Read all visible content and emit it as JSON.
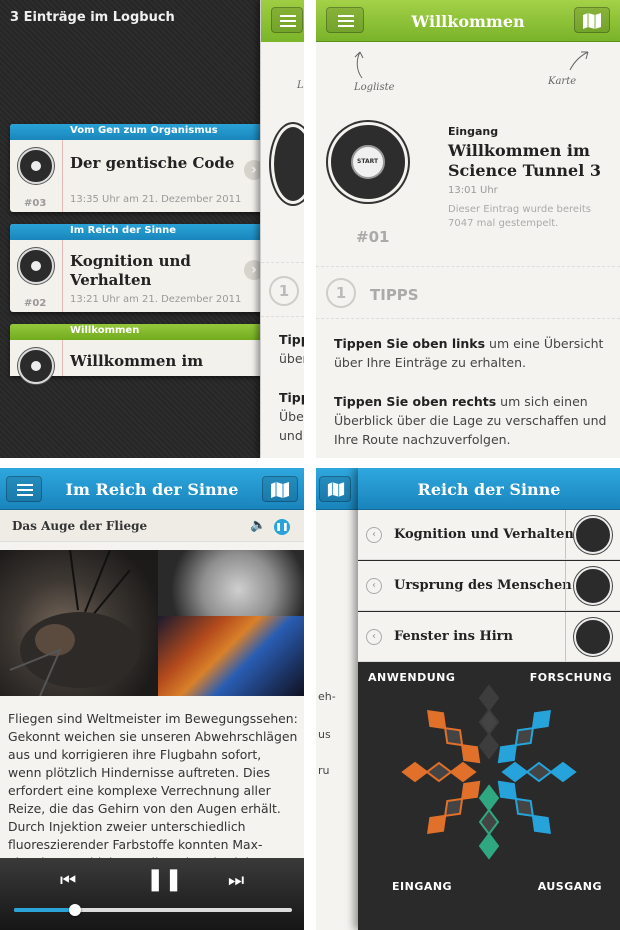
{
  "logbook": {
    "count_label": "3 Einträge im Logbuch",
    "entries": [
      {
        "category": "Vom Gen zum Organismus",
        "title": "Der gentische Code",
        "time": "13:35 Uhr am 21. Dezember 2011",
        "number": "#03",
        "color": "#1e8fc6"
      },
      {
        "category": "Im Reich der Sinne",
        "title": "Kognition und Verhalten",
        "time": "13:21 Uhr am 21. Dezember 2011",
        "number": "#02",
        "color": "#1e8fc6"
      },
      {
        "category": "Willkommen",
        "title": "Willkommen im",
        "time": "",
        "number": "",
        "color": "#7ab52a"
      }
    ],
    "overlay_fragments": [
      "L",
      "1",
      "Tipp",
      "über",
      "Tipp",
      "Übe",
      "und"
    ]
  },
  "welcome": {
    "bar_title": "Willkommen",
    "hint_left": "Logliste",
    "hint_right": "Karte",
    "seal_text": "START",
    "number": "#01",
    "tag": "Eingang",
    "title": "Willkommen im Science Tunnel 3",
    "time": "13:01 Uhr",
    "stamp_text": "Dieser Eintrag wurde bereits 7047 mal gestempelt.",
    "tips_number": "1",
    "tips_title": "TIPPS",
    "tip1_bold": "Tippen Sie oben links",
    "tip1_rest": " um eine Übersicht über Ihre Einträge zu erhalten.",
    "tip2_bold": "Tippen Sie oben rechts",
    "tip2_rest": " um sich einen Überblick über die Lage zu verschaffen und Ihre Route nachzuverfolgen.",
    "accent": "#7ab52a"
  },
  "station": {
    "bar_title": "Im Reich der Sinne",
    "sub_title": "Das Auge der Fliege",
    "body": "Fliegen sind Weltmeister im Bewegungssehen: Gekonnt weichen sie unseren Abwehrschlägen aus und korrigieren ihre Flugbahn sofort, wenn plötzlich Hindernisse auftreten. Dies erfordert eine komplexe Verrechnung aller Reize, die das Gehirn von den Augen erhält. Durch Injektion zweier unterschiedlich fluoreszierender Farbstoffe konnten Max-Planck-Neurobiologen die Reizweiterleitung sichtbar machen.",
    "player_progress": 0.22,
    "accent": "#1e8fc6"
  },
  "menu": {
    "bar_title": "Reich der Sinne",
    "items": [
      "Kognition und Verhalten",
      "Ursprung des Menschen",
      "Fenster ins Hirn"
    ],
    "corners": {
      "tl": "ANWENDUNG",
      "tr": "FORSCHUNG",
      "bl": "EINGANG",
      "br": "AUSGANG"
    },
    "under_fragments": [
      "eh-",
      "us",
      "ru"
    ],
    "colors": {
      "orange": "#e0702a",
      "blue": "#27a3db",
      "teal": "#2fa882",
      "dark": "#3d3d3d"
    }
  }
}
